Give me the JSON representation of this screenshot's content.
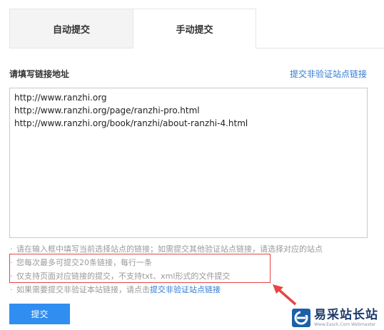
{
  "tabs": [
    {
      "label": "自动提交",
      "active": false
    },
    {
      "label": "手动提交",
      "active": true
    }
  ],
  "form": {
    "url_label": "请填写链接地址",
    "unverified_link": "提交非验证站点链接",
    "urls_value": "http://www.ranzhi.org\nhttp://www.ranzhi.org/page/ranzhi-pro.html\nhttp://www.ranzhi.org/book/ranzhi/about-ranzhi-4.html"
  },
  "hints": {
    "hint1": "请在输入框中填写当前选择站点的链接；如需提交其他验证站点链接，请选择对应的站点",
    "hint2": "您每次最多可提交20条链接，每行一条",
    "hint3": "仅支持页面对应链接的提交，不支持txt、xml形式的文件提交",
    "hint4_prefix": "如果需要提交非验证本站链接，请点击",
    "hint4_link": "提交非验证站点链接"
  },
  "submit_label": "提交",
  "watermark": {
    "title": "易采站长站",
    "subtitle": "Www.Easck.Com Webmaster"
  },
  "colors": {
    "link": "#2f7bd3",
    "button": "#2f8ef0",
    "highlight": "#e64545"
  }
}
